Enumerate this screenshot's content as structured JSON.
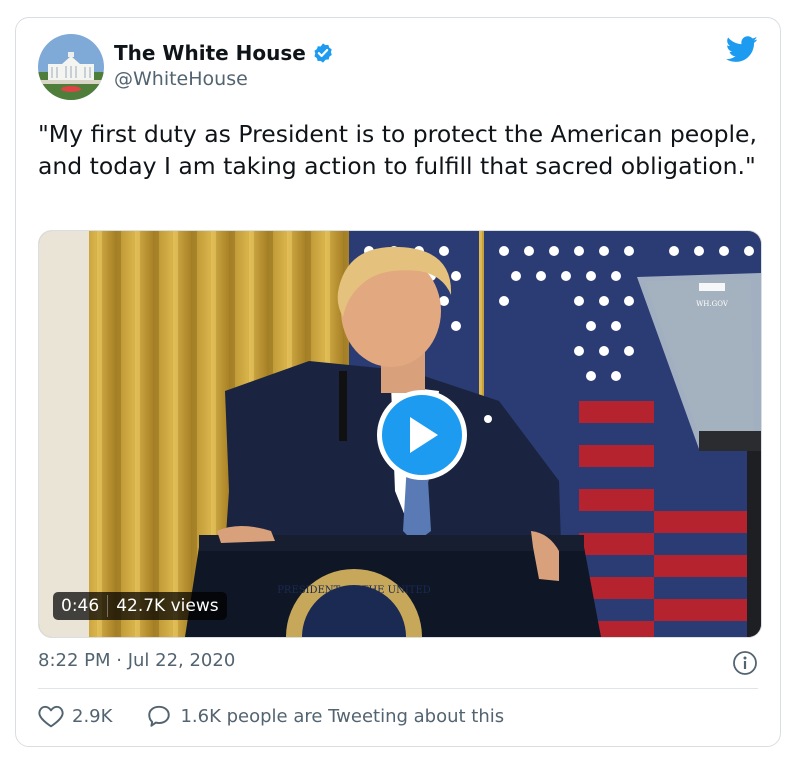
{
  "tweet": {
    "author_name": "The White House",
    "verified": true,
    "handle": "@WhiteHouse",
    "text": "\"My first duty as President is to protect the American people, and today I am taking action to fulfill that sacred obligation.\"",
    "timestamp": "8:22 PM · Jul 22, 2020"
  },
  "video": {
    "duration": "0:46",
    "views": "42.7K views",
    "teleprompter_text": "WH.GOV",
    "seal_text": "PRESIDENT OF THE UNITED"
  },
  "actions": {
    "likes": "2.9K",
    "tweeting": "1.6K people are Tweeting about this"
  },
  "icons": {
    "verified": "verified-badge-icon",
    "brand": "twitter-bird-icon",
    "play": "play-icon",
    "info": "info-icon",
    "like": "heart-icon",
    "reply": "speech-bubble-icon"
  },
  "colors": {
    "accent": "#1d9bf0",
    "text": "#0f1419",
    "secondary": "#536471"
  }
}
